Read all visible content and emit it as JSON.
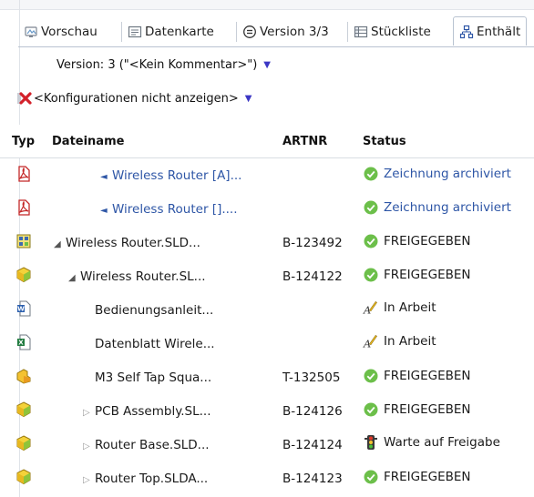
{
  "tabs": [
    {
      "label": "Vorschau",
      "icon": "preview-icon"
    },
    {
      "label": "Datenkarte",
      "icon": "datacard-icon"
    },
    {
      "label": "Version 3/3",
      "icon": "version-icon"
    },
    {
      "label": "Stückliste",
      "icon": "bom-icon"
    },
    {
      "label": "Enthält",
      "icon": "contains-icon",
      "active": true
    }
  ],
  "version_selector": {
    "label": "Version: 3 (\"<Kein Kommentar>\")"
  },
  "config_selector": {
    "label": "<Konfigurationen nicht anzeigen>"
  },
  "table": {
    "headers": [
      "Typ",
      "Dateiname",
      "ARTNR",
      "Status"
    ],
    "rows": [
      {
        "type": "pdf",
        "name": "Wireless Router [A]...",
        "artnr": "",
        "status": "Zeichnung archiviert",
        "status_icon": "check",
        "link": true
      },
      {
        "type": "pdf",
        "name": "Wireless Router []....",
        "artnr": "",
        "status": "Zeichnung archiviert",
        "status_icon": "check",
        "link": true
      },
      {
        "type": "drawing",
        "name": "Wireless Router.SLD...",
        "artnr": "B-123492",
        "status": "FREIGEGEBEN",
        "status_icon": "check",
        "link": false
      },
      {
        "type": "assembly",
        "name": "Wireless Router.SL...",
        "artnr": "B-124122",
        "status": "FREIGEGEBEN",
        "status_icon": "check",
        "link": false
      },
      {
        "type": "word",
        "name": "Bedienungsanleit...",
        "artnr": "",
        "status": "In Arbeit",
        "status_icon": "pen",
        "link": false
      },
      {
        "type": "excel",
        "name": "Datenblatt Wirele...",
        "artnr": "",
        "status": "In Arbeit",
        "status_icon": "pen",
        "link": false
      },
      {
        "type": "part",
        "name": "M3 Self Tap Squa...",
        "artnr": "T-132505",
        "status": "FREIGEGEBEN",
        "status_icon": "check",
        "link": false
      },
      {
        "type": "assembly",
        "name": "PCB Assembly.SL...",
        "artnr": "B-124126",
        "status": "FREIGEGEBEN",
        "status_icon": "check",
        "link": false
      },
      {
        "type": "assembly",
        "name": "Router Base.SLD...",
        "artnr": "B-124124",
        "status": "Warte auf Freigabe",
        "status_icon": "traffic",
        "link": false
      },
      {
        "type": "assembly",
        "name": "Router Top.SLDA...",
        "artnr": "B-124123",
        "status": "FREIGEGEBEN",
        "status_icon": "check",
        "link": false
      }
    ]
  },
  "colors": {
    "link": "#2e56a6",
    "check": "#6cbf4a",
    "dropdown": "#3b36c4"
  }
}
